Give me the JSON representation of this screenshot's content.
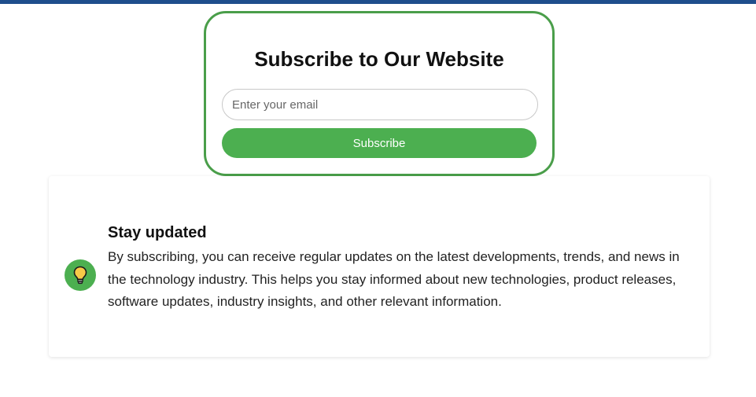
{
  "subscribe": {
    "title": "Subscribe to Our Website",
    "email_placeholder": "Enter your email",
    "email_value": "",
    "button_label": "Subscribe",
    "border_color": "#4a9e4a",
    "button_color": "#4caf50"
  },
  "info": {
    "icon": "lightbulb-icon",
    "title": "Stay updated",
    "body": "By subscribing, you can receive regular updates on the latest developments, trends, and news in the technology industry. This helps you stay informed about new technologies, product releases, software updates, industry insights, and other relevant information."
  },
  "colors": {
    "top_bar": "#1f4e8c",
    "accent_green": "#4caf50"
  }
}
